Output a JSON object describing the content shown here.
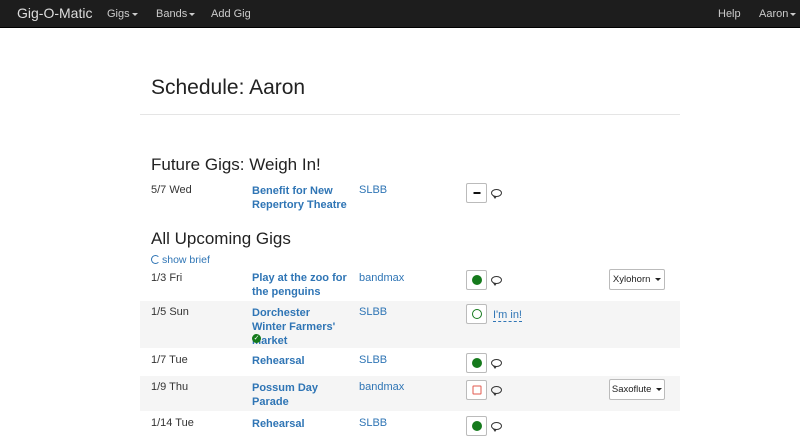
{
  "navbar": {
    "brand": "Gig-O-Matic",
    "items": [
      "Gigs",
      "Bands",
      "Add Gig"
    ],
    "right": [
      "Help",
      "Aaron"
    ]
  },
  "page": {
    "title": "Schedule: Aaron",
    "future_title": "Future Gigs: Weigh In!",
    "upcoming_title": "All Upcoming Gigs",
    "show_brief": "show brief"
  },
  "future_gigs": [
    {
      "date": "5/7 Wed",
      "name": "Benefit for New Repertory Theatre",
      "band": "SLBB",
      "status": "dash"
    }
  ],
  "upcoming_gigs": [
    {
      "date": "1/3 Fri",
      "name": "Play at the zoo for the penguins",
      "band": "bandmax",
      "status": "yes",
      "role": "Xylohorn"
    },
    {
      "date": "1/5 Sun",
      "name": "Dorchester Winter Farmers' Market",
      "band": "SLBB",
      "status": "maybe",
      "status_label": "I'm in!",
      "confirmed": true
    },
    {
      "date": "1/7 Tue",
      "name": "Rehearsal",
      "band": "SLBB",
      "status": "yes"
    },
    {
      "date": "1/9 Thu",
      "name": "Possum Day Parade",
      "band": "bandmax",
      "status": "no",
      "role": "Saxoflute"
    },
    {
      "date": "1/14 Tue",
      "name": "Rehearsal",
      "band": "SLBB",
      "status": "yes"
    }
  ],
  "colors": {
    "navbar": "#1d1d1d",
    "link": "#2f75b5",
    "yes": "#157a1c",
    "no": "#e2584c"
  }
}
